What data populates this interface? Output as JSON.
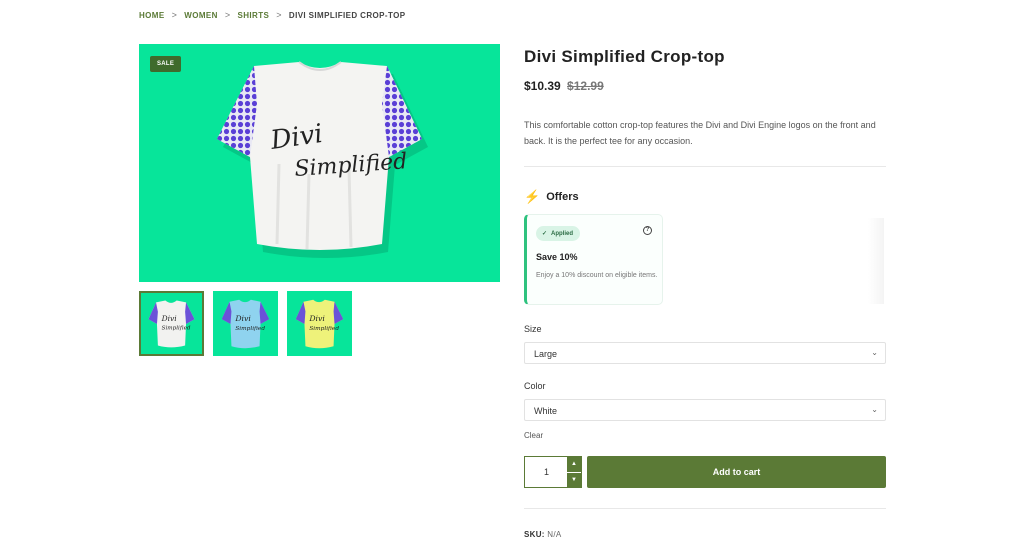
{
  "breadcrumb": {
    "home": "HOME",
    "women": "WOMEN",
    "shirts": "SHIRTS",
    "current": "DIVI SIMPLIFIED CROP-TOP",
    "separator": ">"
  },
  "gallery": {
    "sale_badge": "SALE",
    "shirt_text": [
      "Divi",
      "Simplified"
    ],
    "background_color": "#07e59a",
    "thumbnails": [
      {
        "shirt_color": "#f2f2f0",
        "text": [
          "Divi",
          "Simplified"
        ]
      },
      {
        "shirt_color": "#8fd3ef",
        "text": [
          "Divi",
          "Simplified"
        ]
      },
      {
        "shirt_color": "#eef27a",
        "text": [
          "Divi",
          "Simplified"
        ]
      }
    ]
  },
  "product": {
    "title": "Divi Simplified Crop-top",
    "price_now": "$10.39",
    "price_was": "$12.99",
    "description": "This comfortable cotton crop-top features the Divi and Divi Engine logos on the front and back. It is the perfect tee for any occasion."
  },
  "offers": {
    "heading": "Offers",
    "icon": "lightning-icon",
    "card": {
      "applied_label": "Applied",
      "title": "Save 10%",
      "subtitle": "Enjoy a 10% discount on eligible items."
    }
  },
  "options": {
    "size_label": "Size",
    "size_value": "Large",
    "color_label": "Color",
    "color_value": "White",
    "clear_label": "Clear"
  },
  "cart": {
    "quantity": "1",
    "add_label": "Add to cart"
  },
  "meta": {
    "sku_label": "SKU:",
    "sku_value": "N/A"
  },
  "colors": {
    "accent": "#5b7a36",
    "sale_badge": "#3f6b2c",
    "offer_border": "#2ec27e"
  }
}
